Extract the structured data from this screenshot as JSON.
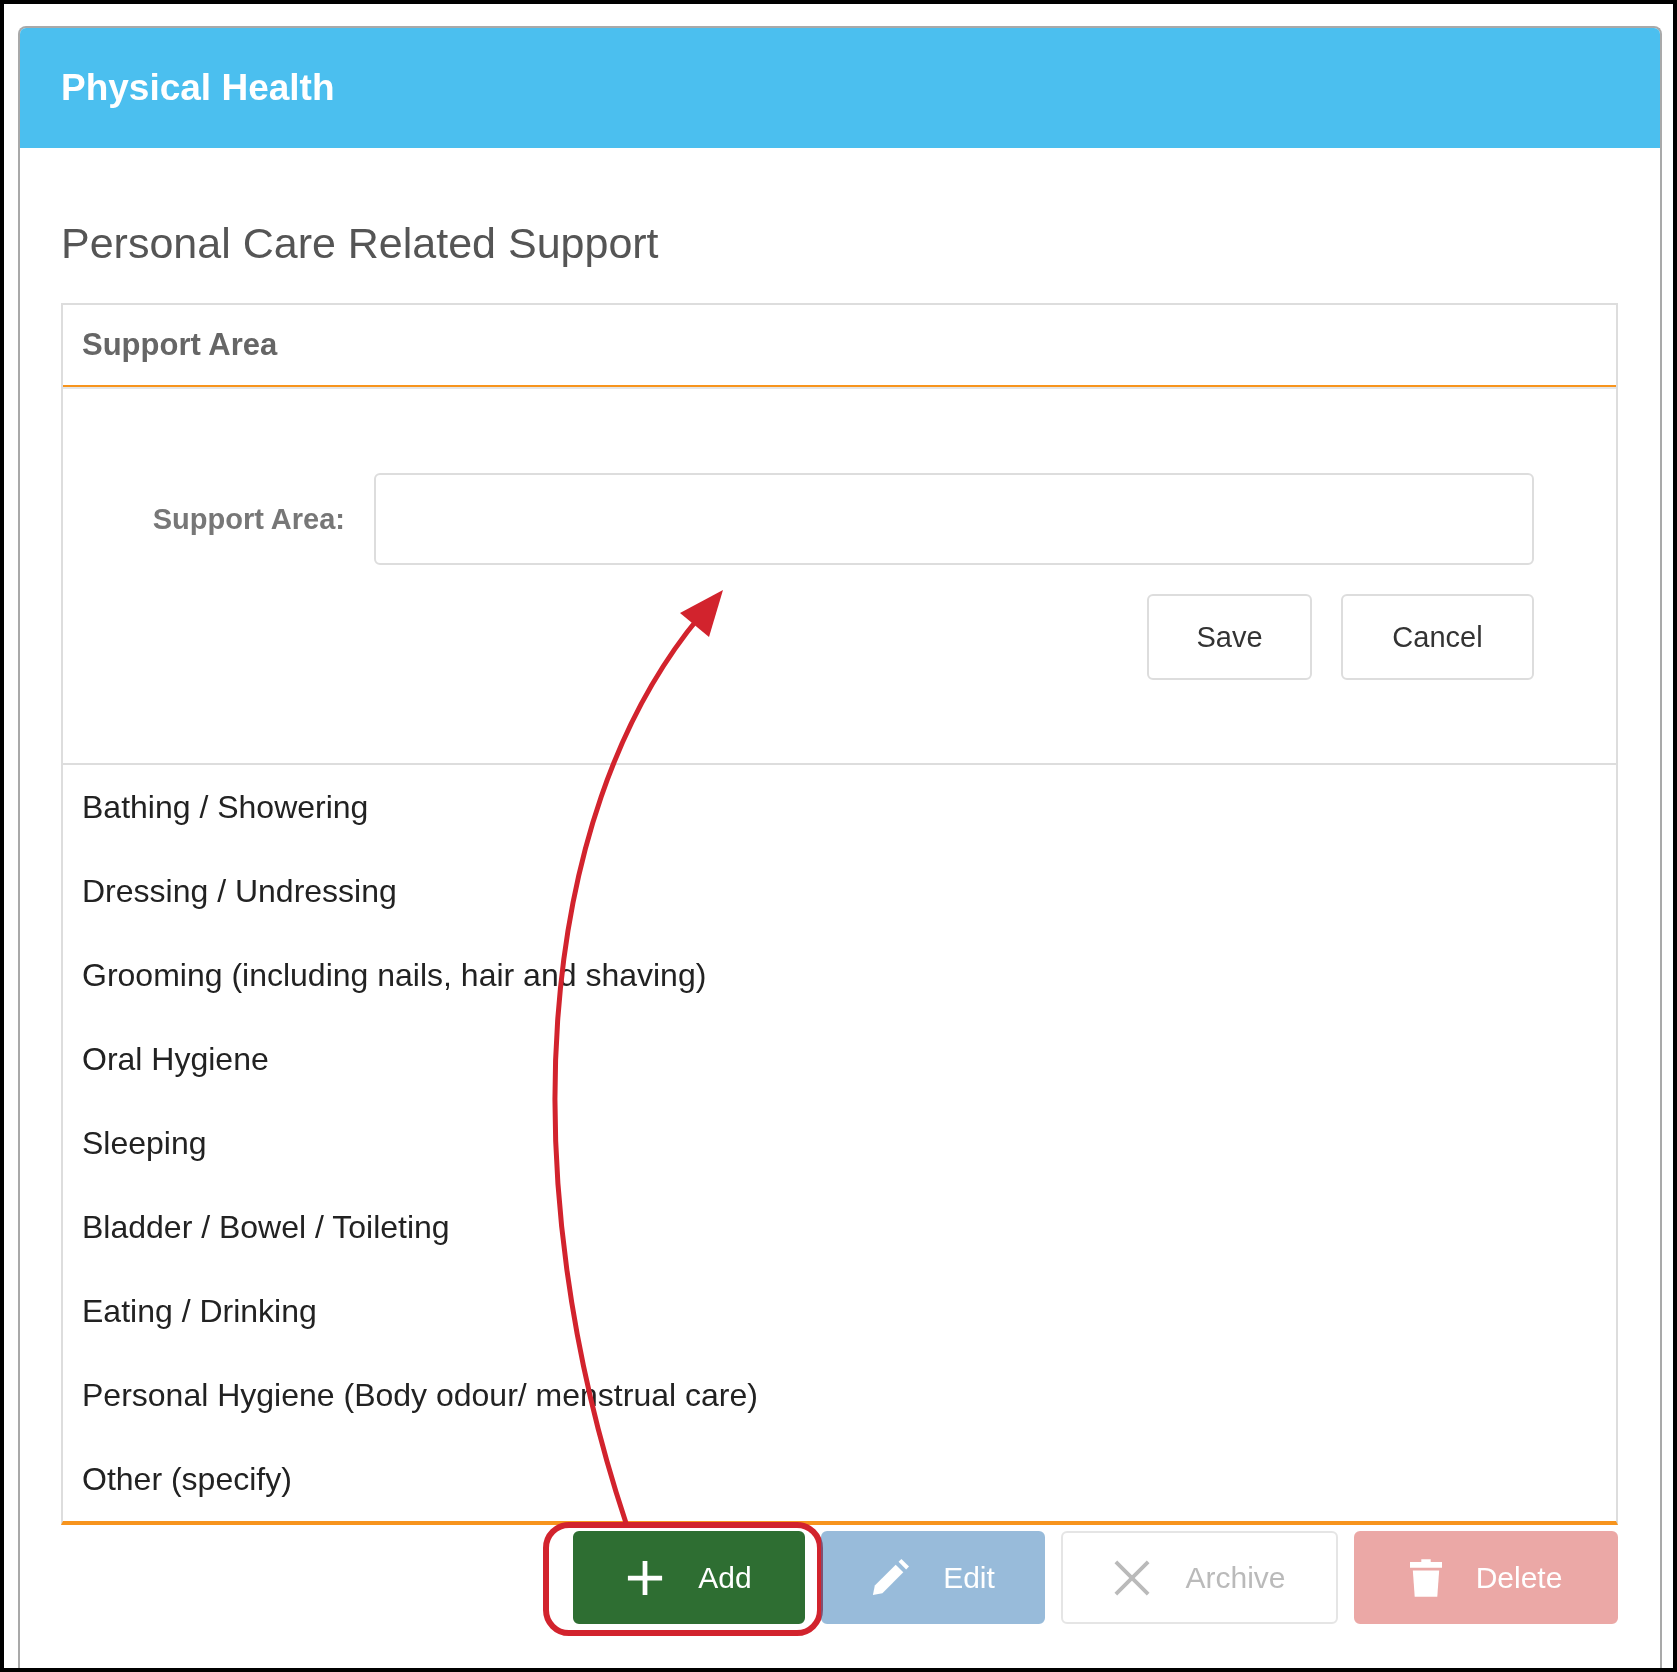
{
  "panel": {
    "title": "Physical Health"
  },
  "section": {
    "title": "Personal Care Related Support"
  },
  "table": {
    "column": "Support Area",
    "form": {
      "label": "Support Area:",
      "buttons": [
        {
          "kind": "save",
          "label": "Save"
        },
        {
          "kind": "cancel",
          "label": "Cancel"
        }
      ]
    },
    "rows": [
      "Bathing / Showering",
      "Dressing / Undressing",
      "Grooming (including nails, hair and shaving)",
      "Oral Hygiene",
      "Sleeping",
      "Bladder / Bowel / Toileting",
      "Eating / Drinking",
      "Personal Hygiene (Body odour/ menstrual care)",
      "Other (specify)"
    ]
  },
  "toolbar": [
    {
      "kind": "add",
      "label": "Add",
      "disabled": false,
      "annotated": true
    },
    {
      "kind": "edit",
      "label": "Edit",
      "disabled": true,
      "annotated": false
    },
    {
      "kind": "archive",
      "label": "Archive",
      "disabled": true,
      "annotated": false
    },
    {
      "kind": "delete",
      "label": "Delete",
      "disabled": true,
      "annotated": false
    }
  ]
}
